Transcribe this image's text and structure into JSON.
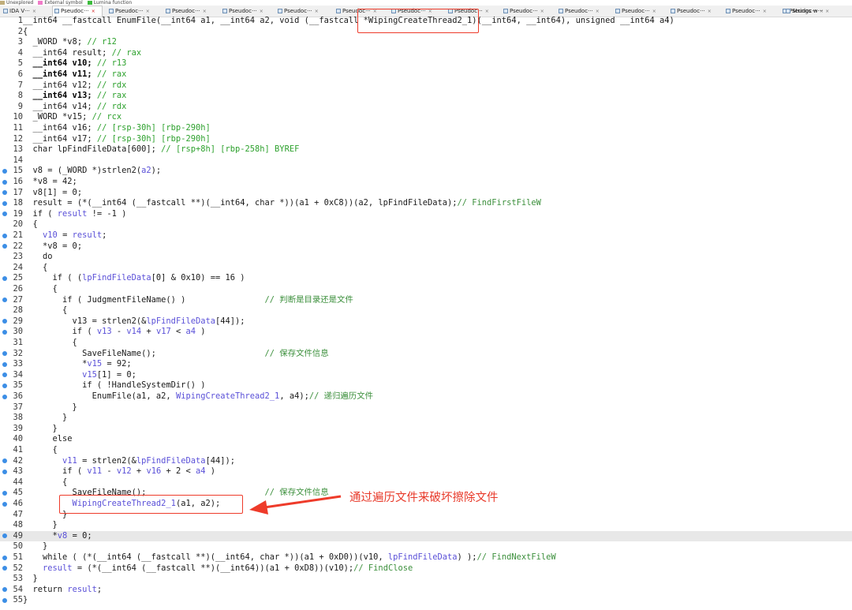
{
  "legend": [
    {
      "label": "Unexplored",
      "color": "#c0ad7a"
    },
    {
      "label": "External symbol",
      "color": "#f07cc8"
    },
    {
      "label": "Lumina function",
      "color": "#3dbb3d"
    }
  ],
  "tabs": [
    {
      "title": "IDA V···",
      "active": false
    },
    {
      "title": "Pseudoc···",
      "active": true
    },
    {
      "title": "Pseudoc···",
      "active": false
    },
    {
      "title": "Pseudoc···",
      "active": false
    },
    {
      "title": "Pseudoc···",
      "active": false
    },
    {
      "title": "Pseudoc···",
      "active": false
    },
    {
      "title": "Pseudoc···",
      "active": false
    },
    {
      "title": "Pseudoc···",
      "active": false
    },
    {
      "title": "Pseudoc···",
      "active": false
    },
    {
      "title": "Pseudoc···",
      "active": false
    },
    {
      "title": "Pseudoc···",
      "active": false
    },
    {
      "title": "Pseudoc···",
      "active": false
    },
    {
      "title": "Pseudoc···",
      "active": false
    },
    {
      "title": "Pseudoc···",
      "active": false
    },
    {
      "title": "Pseudoc···",
      "active": false
    },
    {
      "title": "Strings w···",
      "active": false
    }
  ],
  "code_lines": [
    {
      "n": "1",
      "dot": false,
      "hl": false,
      "tokens": [
        [
          "",
          "__int64 __fastcall EnumFile(__int64 a1, __int64 a2, void (__fastcall *WipingCreateThread2_1)(__int64, __int64), unsigned __int64 a4)"
        ]
      ]
    },
    {
      "n": "2",
      "dot": false,
      "hl": false,
      "tokens": [
        [
          "",
          "{"
        ]
      ]
    },
    {
      "n": "3",
      "dot": false,
      "hl": false,
      "tokens": [
        [
          "",
          "  _WORD *v8; "
        ],
        [
          "c",
          "// r12"
        ]
      ]
    },
    {
      "n": "4",
      "dot": false,
      "hl": false,
      "tokens": [
        [
          "",
          "  __int64 result; "
        ],
        [
          "c",
          "// rax"
        ]
      ]
    },
    {
      "n": "5",
      "dot": false,
      "hl": false,
      "tokens": [
        [
          "k",
          "  __int64 v10; "
        ],
        [
          "c",
          "// r13"
        ]
      ]
    },
    {
      "n": "6",
      "dot": false,
      "hl": false,
      "tokens": [
        [
          "k",
          "  __int64 v11; "
        ],
        [
          "c",
          "// rax"
        ]
      ]
    },
    {
      "n": "7",
      "dot": false,
      "hl": false,
      "tokens": [
        [
          "",
          "  __int64 v12; "
        ],
        [
          "c",
          "// rdx"
        ]
      ]
    },
    {
      "n": "8",
      "dot": false,
      "hl": false,
      "tokens": [
        [
          "k",
          "  __int64 v13; "
        ],
        [
          "c",
          "// rax"
        ]
      ]
    },
    {
      "n": "9",
      "dot": false,
      "hl": false,
      "tokens": [
        [
          "",
          "  __int64 v14; "
        ],
        [
          "c",
          "// rdx"
        ]
      ]
    },
    {
      "n": "10",
      "dot": false,
      "hl": false,
      "tokens": [
        [
          "",
          "  _WORD *v15; "
        ],
        [
          "c",
          "// rcx"
        ]
      ]
    },
    {
      "n": "11",
      "dot": false,
      "hl": false,
      "tokens": [
        [
          "",
          "  __int64 v16; "
        ],
        [
          "c",
          "// [rsp-30h] [rbp-290h]"
        ]
      ]
    },
    {
      "n": "12",
      "dot": false,
      "hl": false,
      "tokens": [
        [
          "",
          "  __int64 v17; "
        ],
        [
          "c",
          "// [rsp-30h] [rbp-290h]"
        ]
      ]
    },
    {
      "n": "13",
      "dot": false,
      "hl": false,
      "tokens": [
        [
          "",
          "  char lpFindFileData[600]; "
        ],
        [
          "c",
          "// [rsp+8h] [rbp-258h] BYREF"
        ]
      ]
    },
    {
      "n": "14",
      "dot": false,
      "hl": false,
      "tokens": [
        [
          "",
          ""
        ]
      ]
    },
    {
      "n": "15",
      "dot": true,
      "hl": false,
      "tokens": [
        [
          "",
          "  v8 = (_WORD *)strlen2("
        ],
        [
          "v",
          "a2"
        ],
        [
          "",
          ");"
        ]
      ]
    },
    {
      "n": "16",
      "dot": true,
      "hl": false,
      "tokens": [
        [
          "",
          "  *v8 = 42;"
        ]
      ]
    },
    {
      "n": "17",
      "dot": true,
      "hl": false,
      "tokens": [
        [
          "",
          "  v8[1] = 0;"
        ]
      ]
    },
    {
      "n": "18",
      "dot": true,
      "hl": false,
      "tokens": [
        [
          "",
          "  result = (*(__int64 (__fastcall **)(__int64, char *))(a1 + 0xC8))(a2, lpFindFileData);"
        ],
        [
          "c2",
          "// FindFirstFileW"
        ]
      ]
    },
    {
      "n": "19",
      "dot": true,
      "hl": false,
      "tokens": [
        [
          "",
          "  if ( "
        ],
        [
          "v",
          "result"
        ],
        [
          "",
          " != -1 )"
        ]
      ]
    },
    {
      "n": "20",
      "dot": false,
      "hl": false,
      "tokens": [
        [
          "",
          "  {"
        ]
      ]
    },
    {
      "n": "21",
      "dot": true,
      "hl": false,
      "tokens": [
        [
          "",
          "    "
        ],
        [
          "v",
          "v10"
        ],
        [
          "",
          " = "
        ],
        [
          "v",
          "result"
        ],
        [
          "",
          ";"
        ]
      ]
    },
    {
      "n": "22",
      "dot": true,
      "hl": false,
      "tokens": [
        [
          "",
          "    *v8 = 0;"
        ]
      ]
    },
    {
      "n": "23",
      "dot": false,
      "hl": false,
      "tokens": [
        [
          "",
          "    do"
        ]
      ]
    },
    {
      "n": "24",
      "dot": false,
      "hl": false,
      "tokens": [
        [
          "",
          "    {"
        ]
      ]
    },
    {
      "n": "25",
      "dot": true,
      "hl": false,
      "tokens": [
        [
          "",
          "      if ( ("
        ],
        [
          "v",
          "lpFindFileData"
        ],
        [
          "",
          "[0] & 0x10) == 16 )"
        ]
      ]
    },
    {
      "n": "26",
      "dot": false,
      "hl": false,
      "tokens": [
        [
          "",
          "      {"
        ]
      ]
    },
    {
      "n": "27",
      "dot": true,
      "hl": false,
      "tokens": [
        [
          "",
          "        if ( JudgmentFileName() )                "
        ],
        [
          "c2",
          "// 判断是目录还是文件"
        ]
      ]
    },
    {
      "n": "28",
      "dot": false,
      "hl": false,
      "tokens": [
        [
          "",
          "        {"
        ]
      ]
    },
    {
      "n": "29",
      "dot": true,
      "hl": false,
      "tokens": [
        [
          "",
          "          v13 = strlen2(&"
        ],
        [
          "v",
          "lpFindFileData"
        ],
        [
          "",
          "[44]);"
        ]
      ]
    },
    {
      "n": "30",
      "dot": true,
      "hl": false,
      "tokens": [
        [
          "",
          "          if ( "
        ],
        [
          "v",
          "v13"
        ],
        [
          "",
          " - "
        ],
        [
          "v",
          "v14"
        ],
        [
          "",
          " + "
        ],
        [
          "v",
          "v17"
        ],
        [
          "",
          " < "
        ],
        [
          "v",
          "a4"
        ],
        [
          "",
          " )"
        ]
      ]
    },
    {
      "n": "31",
      "dot": false,
      "hl": false,
      "tokens": [
        [
          "",
          "          {"
        ]
      ]
    },
    {
      "n": "32",
      "dot": true,
      "hl": false,
      "tokens": [
        [
          "",
          "            SaveFileName();                      "
        ],
        [
          "c2",
          "// 保存文件信息"
        ]
      ]
    },
    {
      "n": "33",
      "dot": true,
      "hl": false,
      "tokens": [
        [
          "",
          "            *"
        ],
        [
          "v",
          "v15"
        ],
        [
          "",
          " = 92;"
        ]
      ]
    },
    {
      "n": "34",
      "dot": true,
      "hl": false,
      "tokens": [
        [
          "",
          "            "
        ],
        [
          "v",
          "v15"
        ],
        [
          "",
          "[1] = 0;"
        ]
      ]
    },
    {
      "n": "35",
      "dot": true,
      "hl": false,
      "tokens": [
        [
          "",
          "            if ( !HandleSystemDir() )"
        ]
      ]
    },
    {
      "n": "36",
      "dot": true,
      "hl": false,
      "tokens": [
        [
          "",
          "              EnumFile(a1, a2, "
        ],
        [
          "v",
          "WipingCreateThread2_1"
        ],
        [
          "",
          ", a4);"
        ],
        [
          "c2",
          "// 递归遍历文件"
        ]
      ]
    },
    {
      "n": "37",
      "dot": false,
      "hl": false,
      "tokens": [
        [
          "",
          "          }"
        ]
      ]
    },
    {
      "n": "38",
      "dot": false,
      "hl": false,
      "tokens": [
        [
          "",
          "        }"
        ]
      ]
    },
    {
      "n": "39",
      "dot": false,
      "hl": false,
      "tokens": [
        [
          "",
          "      }"
        ]
      ]
    },
    {
      "n": "40",
      "dot": false,
      "hl": false,
      "tokens": [
        [
          "",
          "      else"
        ]
      ]
    },
    {
      "n": "41",
      "dot": false,
      "hl": false,
      "tokens": [
        [
          "",
          "      {"
        ]
      ]
    },
    {
      "n": "42",
      "dot": true,
      "hl": false,
      "tokens": [
        [
          "",
          "        "
        ],
        [
          "v",
          "v11"
        ],
        [
          "",
          " = strlen2(&"
        ],
        [
          "v",
          "lpFindFileData"
        ],
        [
          "",
          "[44]);"
        ]
      ]
    },
    {
      "n": "43",
      "dot": true,
      "hl": false,
      "tokens": [
        [
          "",
          "        if ( "
        ],
        [
          "v",
          "v11"
        ],
        [
          "",
          " - "
        ],
        [
          "v",
          "v12"
        ],
        [
          "",
          " + "
        ],
        [
          "v",
          "v16"
        ],
        [
          "",
          " + 2 < "
        ],
        [
          "v",
          "a4"
        ],
        [
          "",
          " )"
        ]
      ]
    },
    {
      "n": "44",
      "dot": false,
      "hl": false,
      "tokens": [
        [
          "",
          "        {"
        ]
      ]
    },
    {
      "n": "45",
      "dot": true,
      "hl": false,
      "tokens": [
        [
          "",
          "          SaveFileName();                        "
        ],
        [
          "c2",
          "// 保存文件信息"
        ]
      ]
    },
    {
      "n": "46",
      "dot": true,
      "hl": false,
      "tokens": [
        [
          "v",
          "          WipingCreateThread2_1"
        ],
        [
          "",
          "(a1, a2);"
        ]
      ]
    },
    {
      "n": "47",
      "dot": false,
      "hl": false,
      "tokens": [
        [
          "",
          "        }"
        ]
      ]
    },
    {
      "n": "48",
      "dot": false,
      "hl": false,
      "tokens": [
        [
          "",
          "      }"
        ]
      ]
    },
    {
      "n": "49",
      "dot": true,
      "hl": true,
      "tokens": [
        [
          "",
          "      *"
        ],
        [
          "v",
          "v8"
        ],
        [
          "",
          " = 0;"
        ]
      ]
    },
    {
      "n": "50",
      "dot": false,
      "hl": false,
      "tokens": [
        [
          "",
          "    }"
        ]
      ]
    },
    {
      "n": "51",
      "dot": true,
      "hl": false,
      "tokens": [
        [
          "",
          "    while ( (*(__int64 (__fastcall **)(__int64, char *))(a1 + 0xD0))(v10, "
        ],
        [
          "v",
          "lpFindFileData"
        ],
        [
          "",
          ") );"
        ],
        [
          "c2",
          "// FindNextFileW"
        ]
      ]
    },
    {
      "n": "52",
      "dot": true,
      "hl": false,
      "tokens": [
        [
          "",
          "    "
        ],
        [
          "v",
          "result"
        ],
        [
          "",
          " = (*(__int64 (__fastcall **)(__int64))(a1 + 0xD8))(v10);"
        ],
        [
          "c2",
          "// FindClose"
        ]
      ]
    },
    {
      "n": "53",
      "dot": false,
      "hl": false,
      "tokens": [
        [
          "",
          "  }"
        ]
      ]
    },
    {
      "n": "54",
      "dot": true,
      "hl": false,
      "tokens": [
        [
          "",
          "  return "
        ],
        [
          "v",
          "result"
        ],
        [
          "",
          ";"
        ]
      ]
    },
    {
      "n": "55",
      "dot": true,
      "hl": false,
      "tokens": [
        [
          "",
          "}"
        ]
      ]
    }
  ],
  "annotation": {
    "text": "通过遍历文件来破坏擦除文件",
    "color": "#e83a2a"
  }
}
